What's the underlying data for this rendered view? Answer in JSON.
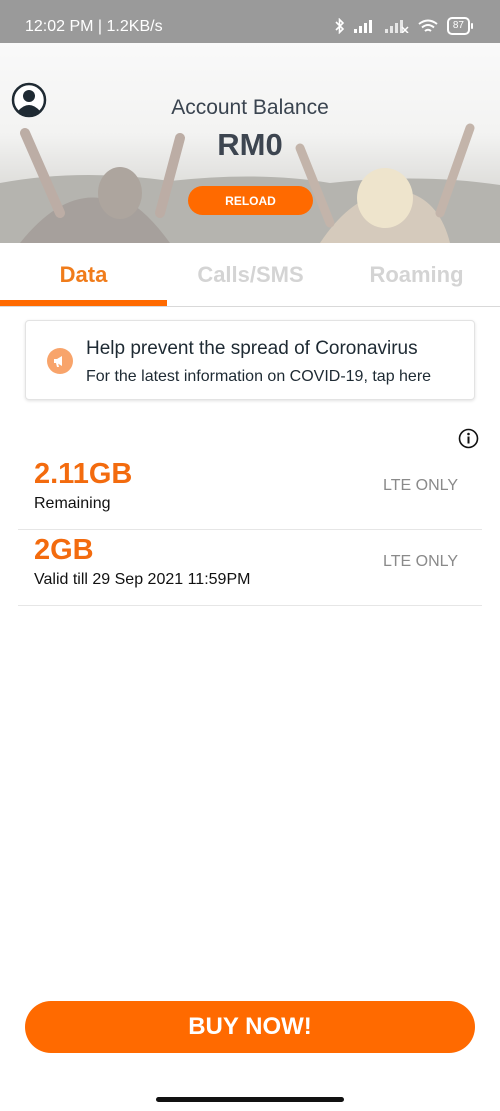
{
  "status_bar": {
    "time_speed": "12:02 PM | 1.2KB/s",
    "battery": "87"
  },
  "header": {
    "balance_label": "Account Balance",
    "balance_amount": "RM0",
    "reload_label": "RELOAD"
  },
  "tabs": [
    {
      "label": "Data",
      "active": true
    },
    {
      "label": "Calls/SMS",
      "active": false
    },
    {
      "label": "Roaming",
      "active": false
    }
  ],
  "notice": {
    "title": "Help prevent the spread of Coronavirus",
    "subtitle": "For the latest information on COVID-19, tap here"
  },
  "data_items": [
    {
      "amount": "2.11GB",
      "caption": "Remaining",
      "tag": "LTE ONLY"
    },
    {
      "amount": "2GB",
      "caption": "Valid till 29 Sep 2021 11:59PM",
      "tag": "LTE ONLY"
    }
  ],
  "buy_button": "BUY NOW!",
  "colors": {
    "accent": "#ff6a00",
    "amount_text": "#f36b0e",
    "inactive_tab": "#d4d4d4"
  },
  "icons": [
    "bluetooth-icon",
    "signal-icon",
    "signal-no-service-icon",
    "wifi-icon",
    "battery-icon",
    "profile-icon",
    "megaphone-icon",
    "info-icon"
  ]
}
